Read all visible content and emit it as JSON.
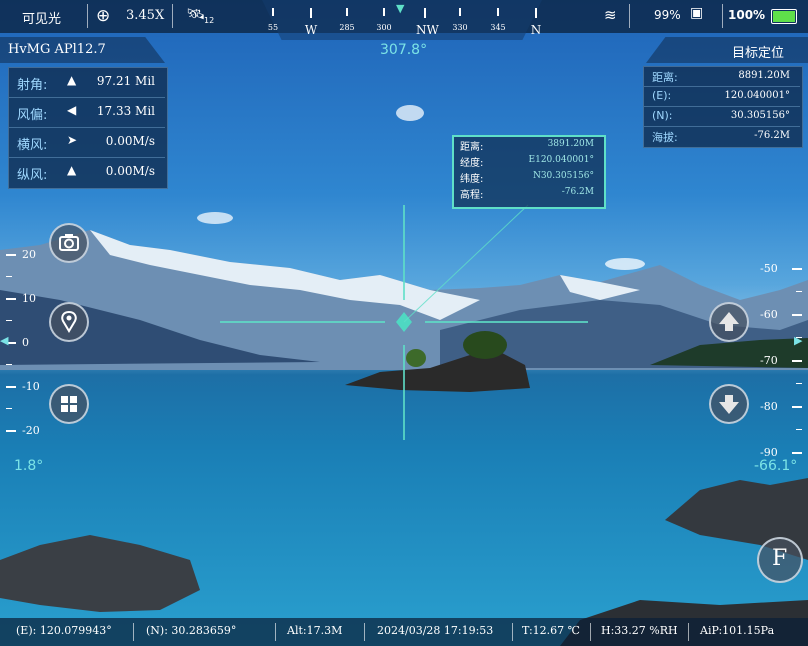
{
  "status": {
    "mode": "可见光",
    "zoom": "3.45X",
    "satellite_count": "12",
    "wifi_battery": "99%",
    "battery": "100%",
    "battery_color": "#5fe04a"
  },
  "compass": {
    "ticks": [
      "55",
      "W",
      "285",
      "300",
      "NW",
      "330",
      "345",
      "N"
    ],
    "heading": "307.8°"
  },
  "device_title": "HvMG APl12.7",
  "target_title": "目标定位",
  "left_panel": [
    {
      "label": "射角:",
      "arrow": "▲",
      "value": "97.21 Mil"
    },
    {
      "label": "风偏:",
      "arrow": "◀",
      "value": "17.33 Mil"
    },
    {
      "label": "横风:",
      "arrow": "➤",
      "value": "0.00M/s"
    },
    {
      "label": "纵风:",
      "arrow": "▲",
      "value": "0.00M/s"
    }
  ],
  "target_panel": [
    {
      "label": "距离:",
      "value": "8891.20M"
    },
    {
      "label": "(E):",
      "value": "120.040001°"
    },
    {
      "label": "(N):",
      "value": "30.305156°"
    },
    {
      "label": "海拔:",
      "value": "-76.2M"
    }
  ],
  "target_popup": [
    {
      "label": "距离:",
      "value": "3891.20M"
    },
    {
      "label": "经度:",
      "value": "E120.040001°"
    },
    {
      "label": "纬度:",
      "value": "N30.305156°"
    },
    {
      "label": "高程:",
      "value": "-76.2M"
    }
  ],
  "left_scale": {
    "ticks": [
      "20",
      "10",
      "0",
      "-10",
      "-20"
    ],
    "value": "1.8°"
  },
  "right_scale": {
    "ticks": [
      "-50",
      "-60",
      "-70",
      "-80",
      "-90"
    ],
    "value": "-66.1°"
  },
  "bottom": {
    "e": "(E): 120.079943°",
    "n": "(N): 30.283659°",
    "alt": "Alt:17.3M",
    "datetime": "2024/03/28 17:19:53",
    "temp": "T:12.67 ℃",
    "humidity": "H:33.27 %RH",
    "airp": "AiP:101.15Pa"
  },
  "buttons": {
    "focus": "F"
  }
}
